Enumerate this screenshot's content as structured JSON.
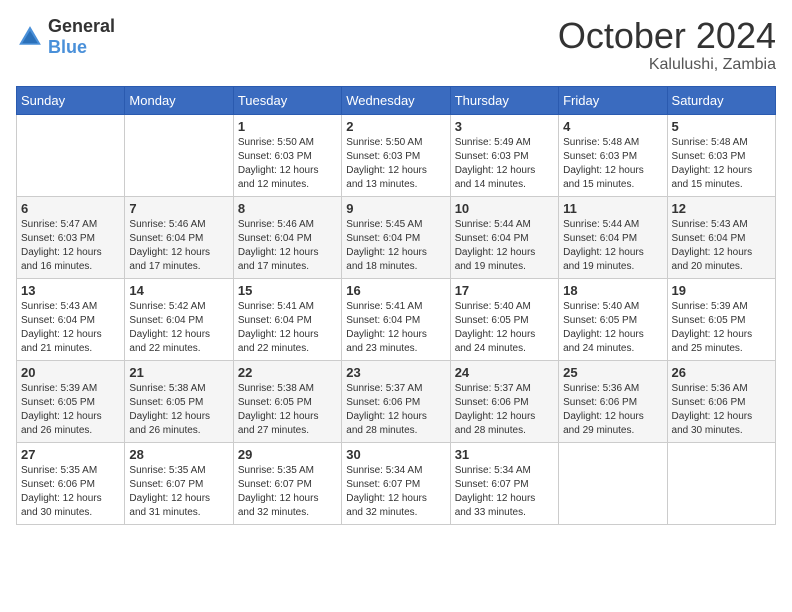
{
  "logo": {
    "general": "General",
    "blue": "Blue"
  },
  "header": {
    "month": "October 2024",
    "location": "Kalulushi, Zambia"
  },
  "weekdays": [
    "Sunday",
    "Monday",
    "Tuesday",
    "Wednesday",
    "Thursday",
    "Friday",
    "Saturday"
  ],
  "weeks": [
    [
      {
        "day": "",
        "info": ""
      },
      {
        "day": "",
        "info": ""
      },
      {
        "day": "1",
        "sunrise": "5:50 AM",
        "sunset": "6:03 PM",
        "daylight": "12 hours and 12 minutes."
      },
      {
        "day": "2",
        "sunrise": "5:50 AM",
        "sunset": "6:03 PM",
        "daylight": "12 hours and 13 minutes."
      },
      {
        "day": "3",
        "sunrise": "5:49 AM",
        "sunset": "6:03 PM",
        "daylight": "12 hours and 14 minutes."
      },
      {
        "day": "4",
        "sunrise": "5:48 AM",
        "sunset": "6:03 PM",
        "daylight": "12 hours and 15 minutes."
      },
      {
        "day": "5",
        "sunrise": "5:48 AM",
        "sunset": "6:03 PM",
        "daylight": "12 hours and 15 minutes."
      }
    ],
    [
      {
        "day": "6",
        "sunrise": "5:47 AM",
        "sunset": "6:03 PM",
        "daylight": "12 hours and 16 minutes."
      },
      {
        "day": "7",
        "sunrise": "5:46 AM",
        "sunset": "6:04 PM",
        "daylight": "12 hours and 17 minutes."
      },
      {
        "day": "8",
        "sunrise": "5:46 AM",
        "sunset": "6:04 PM",
        "daylight": "12 hours and 17 minutes."
      },
      {
        "day": "9",
        "sunrise": "5:45 AM",
        "sunset": "6:04 PM",
        "daylight": "12 hours and 18 minutes."
      },
      {
        "day": "10",
        "sunrise": "5:44 AM",
        "sunset": "6:04 PM",
        "daylight": "12 hours and 19 minutes."
      },
      {
        "day": "11",
        "sunrise": "5:44 AM",
        "sunset": "6:04 PM",
        "daylight": "12 hours and 19 minutes."
      },
      {
        "day": "12",
        "sunrise": "5:43 AM",
        "sunset": "6:04 PM",
        "daylight": "12 hours and 20 minutes."
      }
    ],
    [
      {
        "day": "13",
        "sunrise": "5:43 AM",
        "sunset": "6:04 PM",
        "daylight": "12 hours and 21 minutes."
      },
      {
        "day": "14",
        "sunrise": "5:42 AM",
        "sunset": "6:04 PM",
        "daylight": "12 hours and 22 minutes."
      },
      {
        "day": "15",
        "sunrise": "5:41 AM",
        "sunset": "6:04 PM",
        "daylight": "12 hours and 22 minutes."
      },
      {
        "day": "16",
        "sunrise": "5:41 AM",
        "sunset": "6:04 PM",
        "daylight": "12 hours and 23 minutes."
      },
      {
        "day": "17",
        "sunrise": "5:40 AM",
        "sunset": "6:05 PM",
        "daylight": "12 hours and 24 minutes."
      },
      {
        "day": "18",
        "sunrise": "5:40 AM",
        "sunset": "6:05 PM",
        "daylight": "12 hours and 24 minutes."
      },
      {
        "day": "19",
        "sunrise": "5:39 AM",
        "sunset": "6:05 PM",
        "daylight": "12 hours and 25 minutes."
      }
    ],
    [
      {
        "day": "20",
        "sunrise": "5:39 AM",
        "sunset": "6:05 PM",
        "daylight": "12 hours and 26 minutes."
      },
      {
        "day": "21",
        "sunrise": "5:38 AM",
        "sunset": "6:05 PM",
        "daylight": "12 hours and 26 minutes."
      },
      {
        "day": "22",
        "sunrise": "5:38 AM",
        "sunset": "6:05 PM",
        "daylight": "12 hours and 27 minutes."
      },
      {
        "day": "23",
        "sunrise": "5:37 AM",
        "sunset": "6:06 PM",
        "daylight": "12 hours and 28 minutes."
      },
      {
        "day": "24",
        "sunrise": "5:37 AM",
        "sunset": "6:06 PM",
        "daylight": "12 hours and 28 minutes."
      },
      {
        "day": "25",
        "sunrise": "5:36 AM",
        "sunset": "6:06 PM",
        "daylight": "12 hours and 29 minutes."
      },
      {
        "day": "26",
        "sunrise": "5:36 AM",
        "sunset": "6:06 PM",
        "daylight": "12 hours and 30 minutes."
      }
    ],
    [
      {
        "day": "27",
        "sunrise": "5:35 AM",
        "sunset": "6:06 PM",
        "daylight": "12 hours and 30 minutes."
      },
      {
        "day": "28",
        "sunrise": "5:35 AM",
        "sunset": "6:07 PM",
        "daylight": "12 hours and 31 minutes."
      },
      {
        "day": "29",
        "sunrise": "5:35 AM",
        "sunset": "6:07 PM",
        "daylight": "12 hours and 32 minutes."
      },
      {
        "day": "30",
        "sunrise": "5:34 AM",
        "sunset": "6:07 PM",
        "daylight": "12 hours and 32 minutes."
      },
      {
        "day": "31",
        "sunrise": "5:34 AM",
        "sunset": "6:07 PM",
        "daylight": "12 hours and 33 minutes."
      },
      {
        "day": "",
        "info": ""
      },
      {
        "day": "",
        "info": ""
      }
    ]
  ],
  "labels": {
    "sunrise": "Sunrise:",
    "sunset": "Sunset:",
    "daylight": "Daylight:"
  }
}
